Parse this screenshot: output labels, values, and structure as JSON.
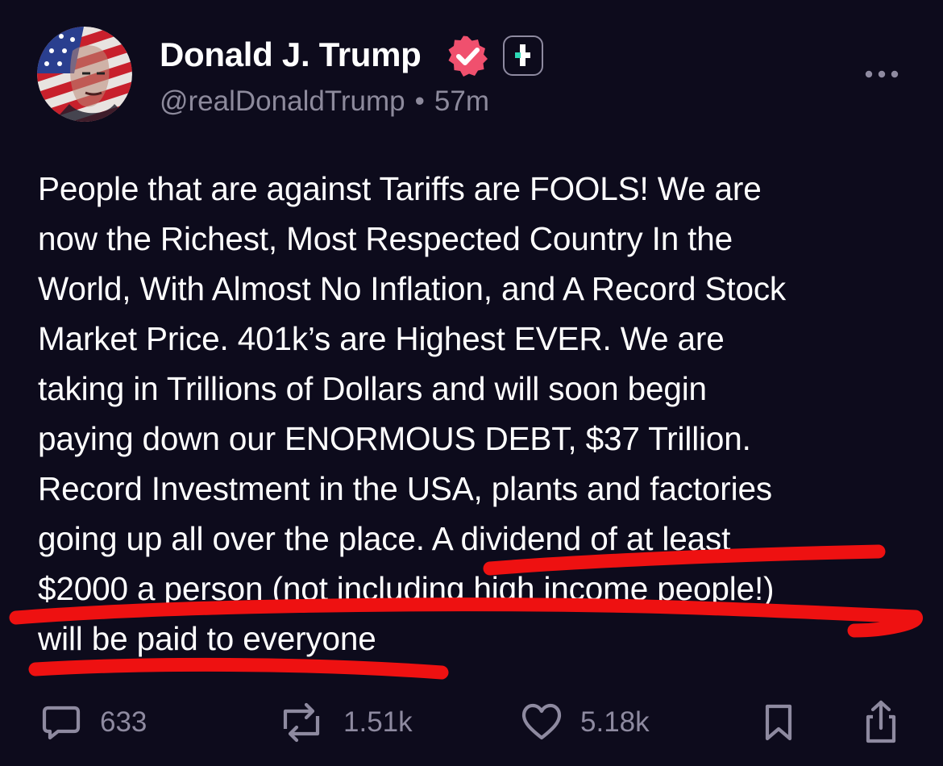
{
  "author": {
    "display_name": "Donald J. Trump",
    "handle": "@realDonaldTrump",
    "separator": "•",
    "time_ago": "57m",
    "avatar_icon": "flag-portrait-avatar",
    "verified_icon": "verified-badge-icon",
    "plus_icon": "plus-badge-icon"
  },
  "menu": {
    "icon": "more-options-icon"
  },
  "post": {
    "text": "People that are against Tariffs are FOOLS! We are now the Richest, Most Respected Country In the World, With Almost No Inflation, and A Record Stock Market Price. 401k’s are Highest EVER. We are taking in Trillions of Dollars and will soon begin paying down our ENORMOUS DEBT, $37 Trillion. Record Investment in the USA, plants and factories going up all over the place. A dividend of at least $2000 a person (not including high income people!) will be paid to everyone",
    "lines": [
      "People that are against Tariffs are FOOLS! We are",
      "now the Richest, Most Respected Country In the",
      "World, With Almost No Inflation, and A Record Stock",
      "Market Price. 401k’s are Highest EVER. We are",
      "taking in Trillions of Dollars and will soon begin",
      "paying down our ENORMOUS DEBT, $37 Trillion.",
      "Record Investment in the USA, plants and factories",
      "going up all over the place. A dividend of at least",
      "$2000 a person (not including high income people!)",
      "will be paid to everyone"
    ]
  },
  "actions": {
    "replies": {
      "count": "633",
      "icon": "reply-icon"
    },
    "reposts": {
      "count": "1.51k",
      "icon": "repost-icon"
    },
    "likes": {
      "count": "5.18k",
      "icon": "heart-icon"
    },
    "bookmark": {
      "icon": "bookmark-icon"
    },
    "share": {
      "icon": "share-icon"
    }
  },
  "colors": {
    "background": "#0d0b1c",
    "text": "#ffffff",
    "muted": "#8d8a9c",
    "verified": "#f0506e",
    "plus_accent": "#2ed8b6",
    "annotation_red": "#ee1111"
  }
}
